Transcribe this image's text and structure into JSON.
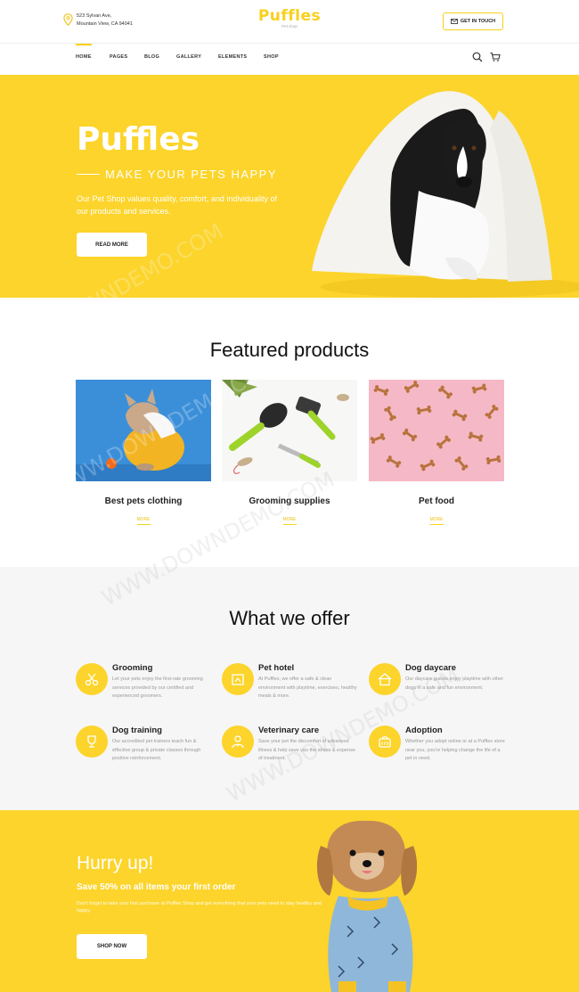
{
  "header": {
    "address_line1": "523 Sylvan Ave,",
    "address_line2": "Mountain View, CA 94041",
    "logo_title": "Puffles",
    "logo_subtitle": "Pet shop",
    "touch_label": "GET IN TOUCH"
  },
  "nav": {
    "items": [
      "HOME",
      "PAGES",
      "BLOG",
      "GALLERY",
      "ELEMENTS",
      "SHOP"
    ]
  },
  "hero": {
    "title": "Puffles",
    "subtitle": "MAKE YOUR PETS HAPPY",
    "text": "Our Pet Shop values quality, comfort, and individuality of our products and services.",
    "button": "READ MORE"
  },
  "featured": {
    "title": "Featured products",
    "cards": [
      {
        "title": "Best pets clothing",
        "link": "MORE"
      },
      {
        "title": "Grooming supplies",
        "link": "MORE"
      },
      {
        "title": "Pet food",
        "link": "MORE"
      }
    ]
  },
  "offer": {
    "title": "What we offer",
    "services": [
      {
        "title": "Grooming",
        "text": "Let your pets enjoy the first-rate grooming services provided by our certified and experienced groomers.",
        "icon": "scissors-icon"
      },
      {
        "title": "Pet hotel",
        "text": "At Puffles, we offer a safe & clean environment with playtime, exercises, healthy meals & more.",
        "icon": "hotel-icon"
      },
      {
        "title": "Dog daycare",
        "text": "Our daycare guests enjoy playtime with other dogs in a safe and fun environment.",
        "icon": "house-icon"
      },
      {
        "title": "Dog training",
        "text": "Our accredited pet trainers teach fun & effective group & private classes through positive reinforcement.",
        "icon": "trophy-icon"
      },
      {
        "title": "Veterinary care",
        "text": "Save your pet the discomfort of advanced illness & help save you the stress & expense of treatment.",
        "icon": "vet-icon"
      },
      {
        "title": "Adoption",
        "text": "Whether you adopt online or at a Puffles store near you, you're helping change the life of a pet in need.",
        "icon": "carrier-icon"
      }
    ]
  },
  "promo": {
    "title": "Hurry up!",
    "subtitle": "Save 50% on all items your first order",
    "text": "Don't forget to take your first purchase at Puffles Shop and get everything that your pets need to stay healthy and happy.",
    "button": "SHOP NOW"
  },
  "watermark": "WWW.DOWNDEMO.COM",
  "colors": {
    "accent": "#fcd42b",
    "text": "#222222"
  }
}
